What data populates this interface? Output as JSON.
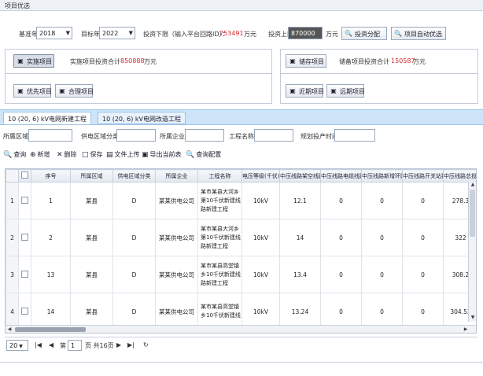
{
  "window": {
    "title": "项目优选"
  },
  "params": {
    "base_year_label": "基准年",
    "base_year_value": "2018",
    "target_year_label": "目标年",
    "target_year_value": "2022",
    "invest_lower_label": "投资下限（输入平台回路ID）：",
    "invest_lower_value": "753491",
    "invest_lower_unit": "万元",
    "invest_upper_label": "投资上限:",
    "invest_upper_value": "870000",
    "invest_upper_unit": "万元",
    "alloc_button": "投资分配",
    "auto_select_button": "项目自动优选"
  },
  "panels": {
    "implement_button": "实施项目",
    "implement_total_label": "实施项目投资合计",
    "implement_total_value": "850888",
    "implement_total_unit": "万元",
    "reserve_button": "储存项目",
    "reserve_total_label": "储备项目投资合计",
    "reserve_total_value": "150587",
    "reserve_total_unit": "万元",
    "priority_button": "优先项目",
    "merge_button": "合理项目",
    "near_button": "近期项目",
    "far_button": "远期项目"
  },
  "tabs": [
    {
      "label": "10 (20, 6) kV电网新建工程",
      "active": true
    },
    {
      "label": "10 (20, 6) kV电网改造工程",
      "active": false
    }
  ],
  "filters": {
    "area_label": "所属区域:",
    "supply_label": "供电区域分类:",
    "company_label": "所属企业:",
    "project_label": "工程名称:",
    "year_label": "规划投产时间:"
  },
  "toolbar": {
    "query": "查询",
    "add": "新增",
    "delete": "删除",
    "save": "保存",
    "upload": "文件上传",
    "export": "导出当前表",
    "config": "查询配置"
  },
  "table": {
    "columns": [
      "序号",
      "所属区域",
      "供电区域分类",
      "所属企业",
      "工程名称",
      "电压等级(千伏)",
      "中压线路架空线路",
      "中压线路电缆线路",
      "中压线路新增环网",
      "中压线路开关站建设",
      "中压线路总投资"
    ],
    "rows": [
      {
        "rn": "1",
        "no": "1",
        "area": "某县",
        "cls": "D",
        "company": "某某供电公司",
        "project": "某市某县大河乡第10千伏新建线路新建工程",
        "kv": "10kV",
        "overhead": "12.1",
        "cable": "0",
        "ring": "0",
        "switch": "0",
        "total": "278.3"
      },
      {
        "rn": "2",
        "no": "2",
        "area": "某县",
        "cls": "D",
        "company": "某某供电公司",
        "project": "某市某县大河乡第10千伏新建线路新建工程",
        "kv": "10kV",
        "overhead": "14",
        "cable": "0",
        "ring": "0",
        "switch": "0",
        "total": "322"
      },
      {
        "rn": "3",
        "no": "13",
        "area": "某县",
        "cls": "D",
        "company": "某某供电公司",
        "project": "某市某县高堂镇乡10千伏新建线路新建工程",
        "kv": "10kV",
        "overhead": "13.4",
        "cable": "0",
        "ring": "0",
        "switch": "0",
        "total": "308.2"
      },
      {
        "rn": "4",
        "no": "14",
        "area": "某县",
        "cls": "D",
        "company": "某某供电公司",
        "project": "某市某县高堂镇乡10千伏新建线",
        "kv": "10kV",
        "overhead": "13.24",
        "cable": "0",
        "ring": "0",
        "switch": "0",
        "total": "304.52"
      }
    ]
  },
  "pager": {
    "page_size": "20",
    "page_label": "第",
    "page_value": "1",
    "total_label": "页 共16页"
  }
}
